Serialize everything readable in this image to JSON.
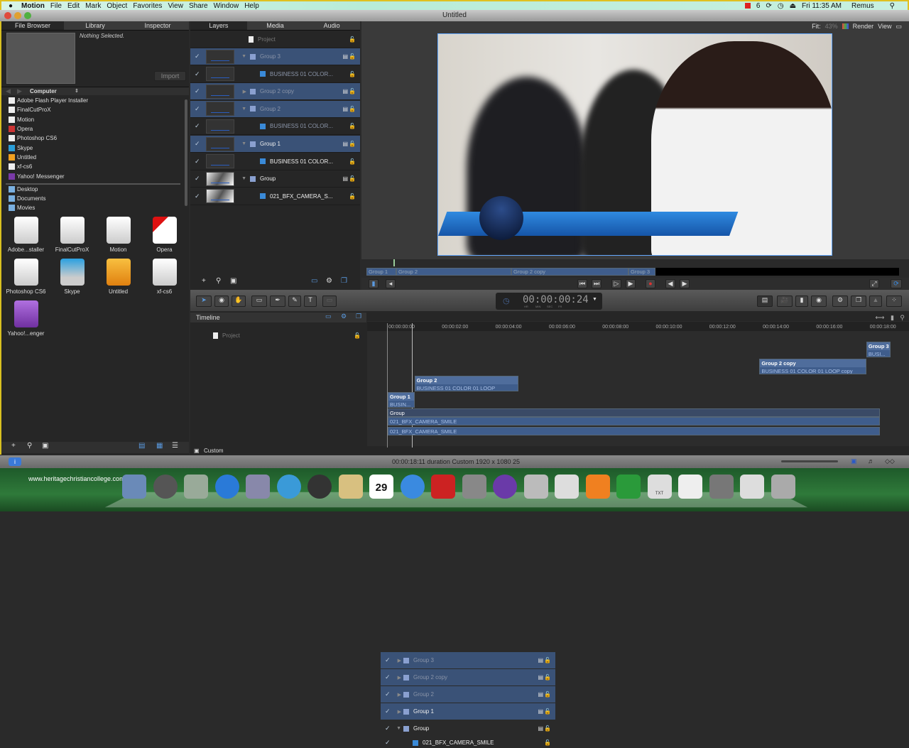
{
  "menubar": {
    "apple": "",
    "app": "Motion",
    "items": [
      "File",
      "Edit",
      "Mark",
      "Object",
      "Favorites",
      "View",
      "Share",
      "Window",
      "Help"
    ],
    "status": {
      "adobe": "6",
      "clock": "Fri 11:35 AM",
      "user": "Remus"
    }
  },
  "window": {
    "title": "Untitled"
  },
  "left_panel": {
    "tabs": [
      "File Browser",
      "Library",
      "Inspector"
    ],
    "preview_text": "Nothing Selected.",
    "import_label": "Import",
    "location": "Computer",
    "files": [
      "Adobe Flash Player Installer",
      "FinalCutProX",
      "Motion",
      "Opera",
      "Photoshop CS6",
      "Skype",
      "Untitled",
      "xf-cs6",
      "Yahoo! Messenger"
    ],
    "places": [
      "Desktop",
      "Documents",
      "Movies"
    ],
    "icons": [
      "Adobe...staller",
      "FinalCutProX",
      "Motion",
      "Opera",
      "Photoshop CS6",
      "Skype",
      "Untitled",
      "xf-cs6",
      "Yahoo!...enger"
    ]
  },
  "layers_panel": {
    "tabs": [
      "Layers",
      "Media",
      "Audio"
    ],
    "project": "Project",
    "rows": [
      {
        "name": "Group 3",
        "kind": "group",
        "selected": true
      },
      {
        "name": "BUSINESS 01 COLOR...",
        "kind": "clip",
        "selected": false
      },
      {
        "name": "Group 2 copy",
        "kind": "group",
        "selected": true
      },
      {
        "name": "Group 2",
        "kind": "group",
        "selected": true
      },
      {
        "name": "BUSINESS 01 COLOR...",
        "kind": "clip",
        "selected": false
      },
      {
        "name": "Group 1",
        "kind": "group",
        "selected": true
      },
      {
        "name": "BUSINESS 01 COLOR...",
        "kind": "clip",
        "selected": false
      },
      {
        "name": "Group",
        "kind": "group",
        "selected": false
      },
      {
        "name": "021_BFX_CAMERA_S...",
        "kind": "clip",
        "selected": false
      }
    ]
  },
  "canvas": {
    "fit_label": "Fit:",
    "fit_value": "43%",
    "render": "Render",
    "view": "View"
  },
  "mini_timeline": [
    "Group 1",
    "Group 2",
    "Group 2 copy",
    "Group 3"
  ],
  "timecode": {
    "value": "00:00:00:24",
    "units": [
      "HR",
      "MIN",
      "SEC",
      "FR"
    ]
  },
  "timeline": {
    "title": "Timeline",
    "project": "Project",
    "rows": [
      {
        "name": "Group 3",
        "selected": true
      },
      {
        "name": "Group 2 copy",
        "selected": true
      },
      {
        "name": "Group 2",
        "selected": true
      },
      {
        "name": "Group 1",
        "selected": true
      },
      {
        "name": "Group",
        "selected": false
      },
      {
        "name": "021_BFX_CAMERA_SMILE",
        "selected": false
      }
    ],
    "ruler": [
      "00:00:00:00",
      "00:00:02:00",
      "00:00:04:00",
      "00:00:06:00",
      "00:00:08:00",
      "00:00:10:00",
      "00:00:12:00",
      "00:00:14:00",
      "00:00:16:00",
      "00:00:18:00"
    ],
    "clips": [
      {
        "group": "Group 3",
        "clip": "BUSI..."
      },
      {
        "group": "Group 2 copy",
        "clip": "BUSINESS 01 COLOR 01 LOOP copy"
      },
      {
        "group": "Group 2",
        "clip": "BUSINESS 01 COLOR 01 LOOP"
      },
      {
        "group": "Group 1",
        "clip": "BUSIN..."
      },
      {
        "group": "Group",
        "clip": "021_BFX_CAMERA_SMILE",
        "clip2": "021_BFX_CAMERA_SMILE"
      }
    ],
    "preset": "Custom"
  },
  "status_bar": {
    "text": "00:00:18:11 duration Custom 1920 x 1080 25"
  },
  "dock": {
    "watermark": "www.heritagechristiancollege.com",
    "calendar_day": "29",
    "file_label": "TXT"
  },
  "colors": {
    "accent": "#3a5277",
    "clip": "#3f5d8c",
    "selection": "#2a5dbf"
  }
}
